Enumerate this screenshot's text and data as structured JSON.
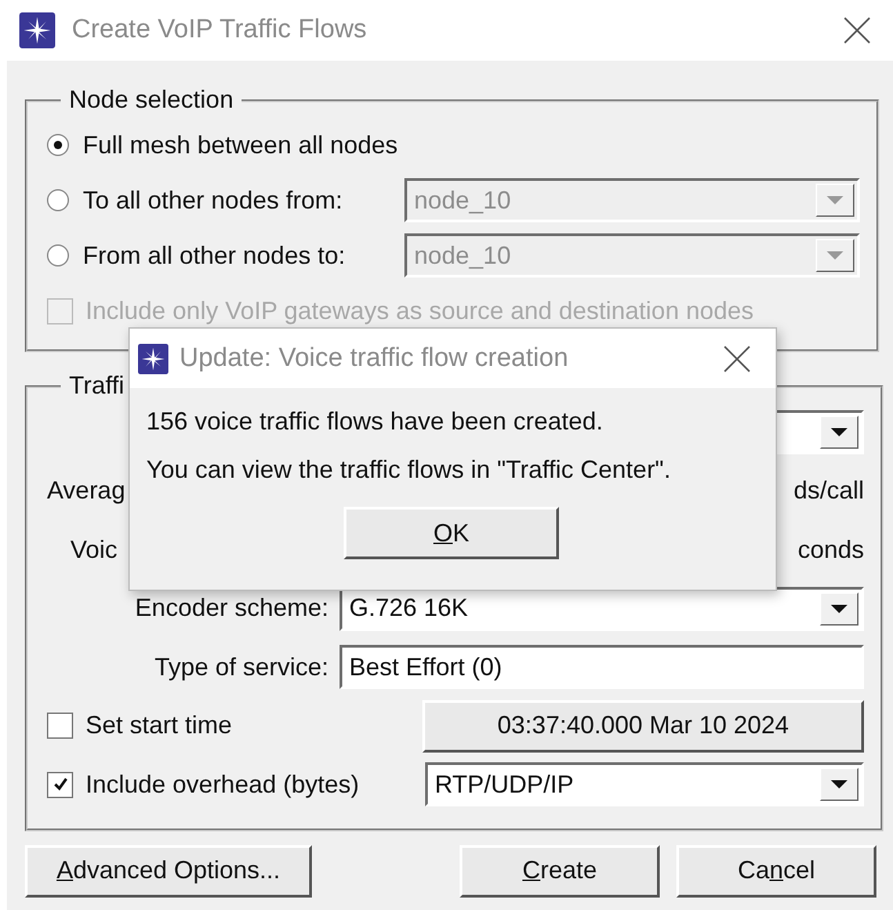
{
  "window": {
    "title": "Create VoIP Traffic Flows"
  },
  "node_selection": {
    "title": "Node selection",
    "options": [
      {
        "label": "Full mesh between all nodes",
        "selected": true
      },
      {
        "label": "To all other nodes from:",
        "selected": false,
        "node": "node_10"
      },
      {
        "label": "From all other nodes to:",
        "selected": false,
        "node": "node_10"
      }
    ],
    "gateways_only": {
      "label": "Include only VoIP gateways as source and destination nodes",
      "checked": false,
      "disabled": true
    }
  },
  "traffic": {
    "title": "Traffi",
    "hidden_rows": [
      {
        "left": "Averag",
        "right": "ds/call"
      },
      {
        "left": "Voic",
        "right": "conds"
      }
    ],
    "encoder": {
      "label": "Encoder scheme:",
      "value": "G.726 16K"
    },
    "service": {
      "label": "Type of service:",
      "value": "Best Effort (0)"
    },
    "start_time": {
      "label": "Set start time",
      "checked": false,
      "value": "03:37:40.000 Mar 10 2024"
    },
    "overhead": {
      "label": "Include overhead (bytes)",
      "checked": true,
      "value": "RTP/UDP/IP"
    }
  },
  "buttons": [
    {
      "access_key": "A",
      "label_after": "dvanced Options..."
    },
    {
      "access_key": "C",
      "label_after": "reate"
    },
    {
      "label_before": "Ca",
      "access_key": "n",
      "label_after": "cel"
    }
  ],
  "popup": {
    "title": "Update: Voice traffic flow creation",
    "lines": [
      "156 voice traffic flows have been created.",
      "You can view the traffic flows in \"Traffic Center\"."
    ],
    "button": {
      "access_key": "O",
      "label_after": "K"
    }
  }
}
